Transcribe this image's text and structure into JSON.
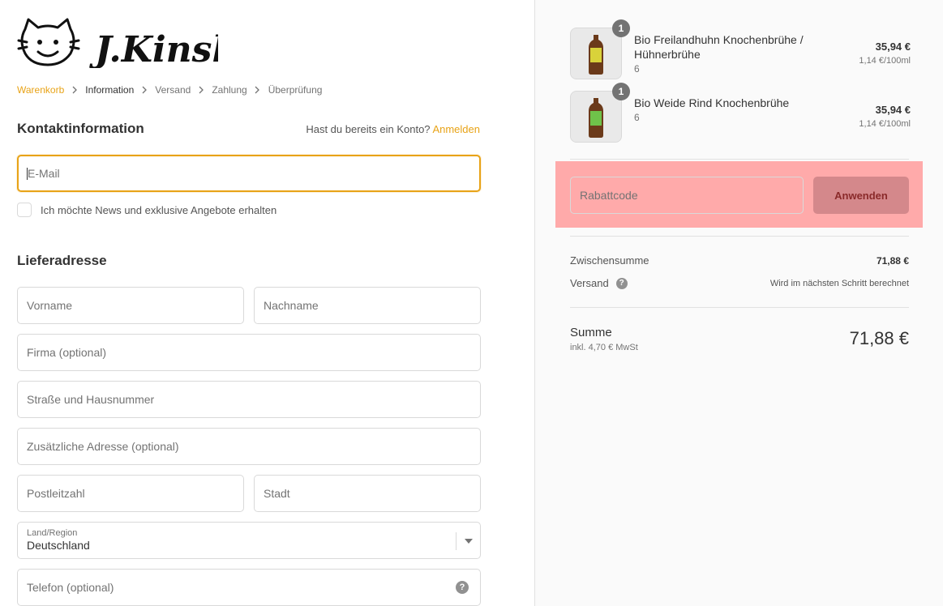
{
  "brand": {
    "logo_text": "J.Kinski"
  },
  "breadcrumb": [
    {
      "label": "Warenkorb",
      "state": "link"
    },
    {
      "label": "Information",
      "state": "current"
    },
    {
      "label": "Versand",
      "state": "upcoming"
    },
    {
      "label": "Zahlung",
      "state": "upcoming"
    },
    {
      "label": "Überprüfung",
      "state": "upcoming"
    }
  ],
  "contact": {
    "title": "Kontaktinformation",
    "account_prompt": "Hast du bereits ein Konto?",
    "login_link": "Anmelden",
    "email_placeholder": "E-Mail",
    "newsletter_label": "Ich möchte News und exklusive Angebote erhalten"
  },
  "shipping": {
    "title": "Lieferadresse",
    "first_name_placeholder": "Vorname",
    "last_name_placeholder": "Nachname",
    "company_placeholder": "Firma (optional)",
    "street_placeholder": "Straße und Hausnummer",
    "address2_placeholder": "Zusätzliche Adresse (optional)",
    "zip_placeholder": "Postleitzahl",
    "city_placeholder": "Stadt",
    "country_label": "Land/Region",
    "country_value": "Deutschland",
    "phone_placeholder": "Telefon (optional)"
  },
  "cart": {
    "items": [
      {
        "name": "Bio Freilandhuhn Knochenbrühe / Hühnerbrühe",
        "variant": "6",
        "quantity": "1",
        "price": "35,94 €",
        "unit_price": "1,14 €/100ml",
        "label_color": "#d9d23a"
      },
      {
        "name": "Bio Weide Rind Knochenbrühe",
        "variant": "6",
        "quantity": "1",
        "price": "35,94 €",
        "unit_price": "1,14 €/100ml",
        "label_color": "#6fc24a"
      }
    ]
  },
  "discount": {
    "placeholder": "Rabattcode",
    "button_label": "Anwenden"
  },
  "summary": {
    "subtotal_label": "Zwischensumme",
    "subtotal_value": "71,88 €",
    "shipping_label": "Versand",
    "shipping_value": "Wird im nächsten Schritt berechnet",
    "total_label": "Summe",
    "tax_note": "inkl. 4,70 € MwSt",
    "total_value": "71,88 €"
  },
  "colors": {
    "accent": "#e8a317",
    "highlight": "#ffaaaa",
    "button": "#d4888b"
  }
}
